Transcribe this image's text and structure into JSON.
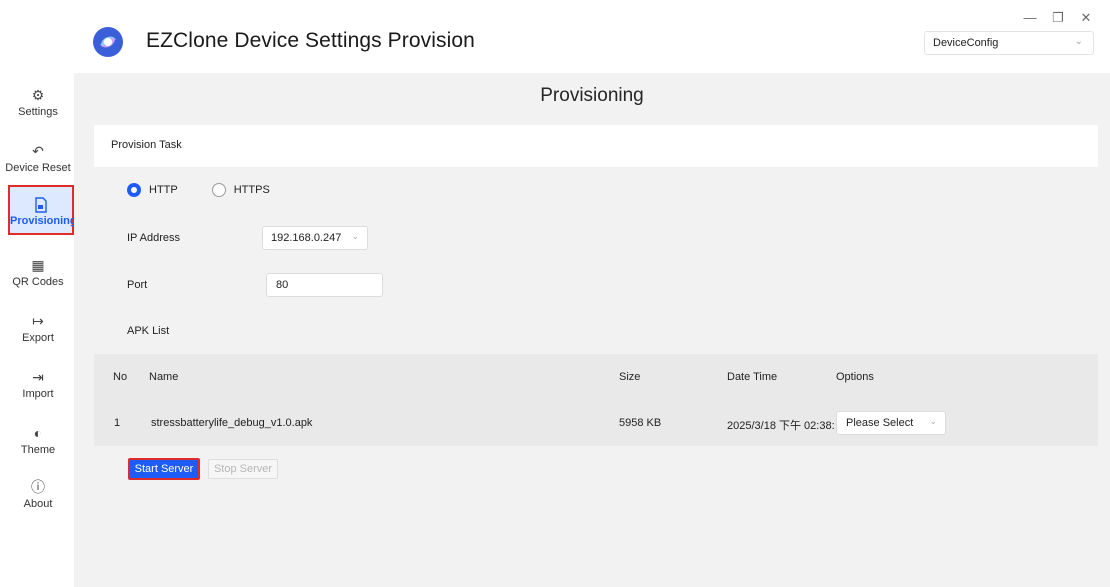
{
  "app": {
    "title": "EZClone Device Settings Provision",
    "config_select": "DeviceConfig",
    "window_controls": [
      "minimize-icon",
      "restore-icon",
      "close-icon"
    ]
  },
  "sidebar": {
    "items": [
      {
        "label": "Settings",
        "icon": "gear-icon"
      },
      {
        "label": "Device Reset",
        "icon": "undo-icon"
      },
      {
        "label": "Provisioning",
        "icon": "file-lock-icon",
        "active": true
      },
      {
        "label": "QR Codes",
        "icon": "qr-code-icon"
      },
      {
        "label": "Export",
        "icon": "export-arrow-icon"
      },
      {
        "label": "Import",
        "icon": "import-arrow-icon"
      },
      {
        "label": "Theme",
        "icon": "half-circle-icon"
      },
      {
        "label": "About",
        "icon": "info-icon"
      }
    ]
  },
  "main": {
    "page_title": "Provisioning",
    "task_title": "Provision Task",
    "protocol": {
      "options": [
        "HTTP",
        "HTTPS"
      ],
      "selected": "HTTP"
    },
    "ip_label": "IP Address",
    "ip_value": "192.168.0.247",
    "port_label": "Port",
    "port_value": "80",
    "apk_list_label": "APK List",
    "table": {
      "headers": {
        "no": "No",
        "name": "Name",
        "size": "Size",
        "datetime": "Date Time",
        "options": "Options"
      },
      "rows": [
        {
          "no": "1",
          "name": "stressbatterylife_debug_v1.0.apk",
          "size": "5958 KB",
          "datetime": "2025/3/18 下午 02:38:",
          "option": "Please Select"
        }
      ]
    },
    "start_button": "Start Server",
    "stop_button": "Stop Server"
  },
  "colors": {
    "accent": "#1d5cf6",
    "highlight_border": "#e02b2b",
    "active_bg": "#dde9ff",
    "main_bg": "#f2f2f2"
  }
}
